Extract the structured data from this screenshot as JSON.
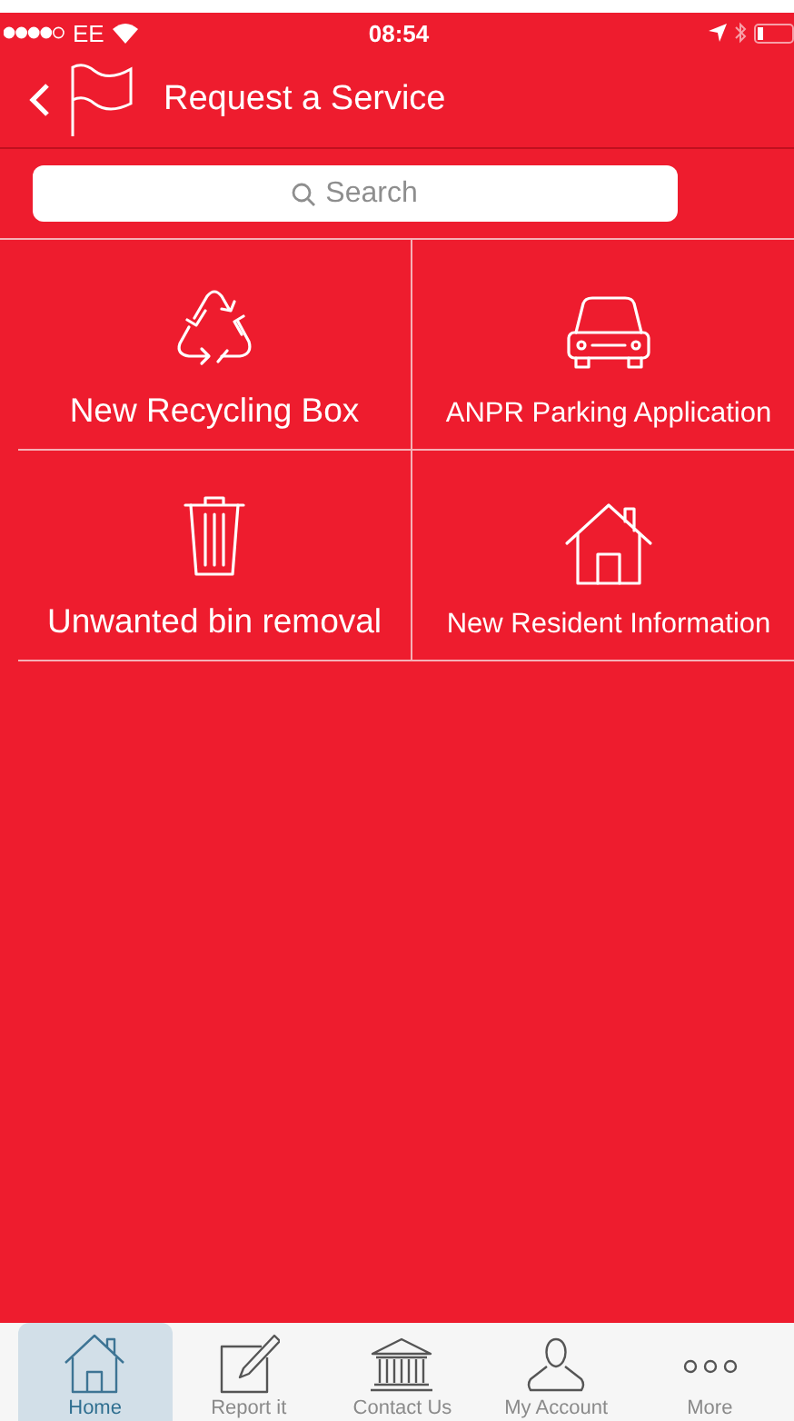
{
  "status_bar": {
    "carrier": "EE",
    "time": "08:54"
  },
  "header": {
    "title": "Request a Service"
  },
  "search": {
    "placeholder": "Search"
  },
  "services": [
    {
      "label": "New Recycling Box"
    },
    {
      "label": "ANPR Parking Application"
    },
    {
      "label": "Unwanted bin removal"
    },
    {
      "label": "New Resident Information"
    }
  ],
  "tab_bar": [
    {
      "label": "Home",
      "selected": true
    },
    {
      "label": "Report it",
      "selected": false
    },
    {
      "label": "Contact Us",
      "selected": false
    },
    {
      "label": "My Account",
      "selected": false
    },
    {
      "label": "More",
      "selected": false
    }
  ]
}
